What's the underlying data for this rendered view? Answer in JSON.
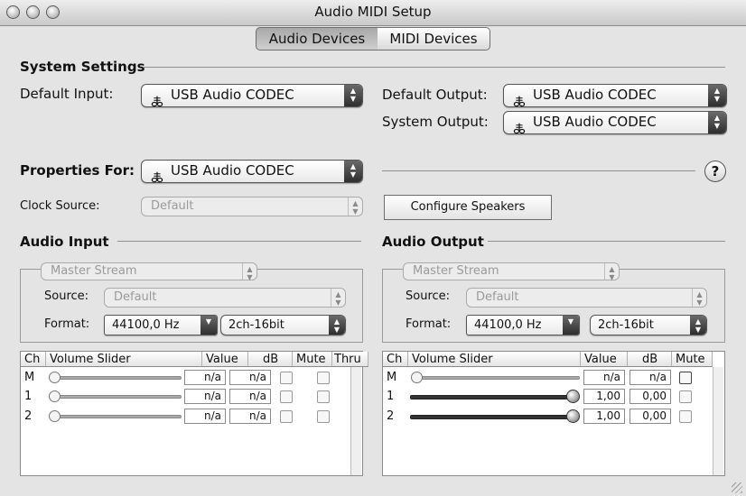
{
  "window": {
    "title": "Audio MIDI Setup"
  },
  "tabs": [
    {
      "label": "Audio Devices",
      "selected": true
    },
    {
      "label": "MIDI Devices",
      "selected": false
    }
  ],
  "system_settings": {
    "heading": "System Settings",
    "default_input_label": "Default Input:",
    "default_input_value": "USB Audio CODEC",
    "default_output_label": "Default Output:",
    "default_output_value": "USB Audio CODEC",
    "system_output_label": "System Output:",
    "system_output_value": "USB Audio CODEC"
  },
  "properties": {
    "label": "Properties For:",
    "value": "USB Audio CODEC",
    "help_label": "?",
    "clock_source_label": "Clock Source:",
    "clock_source_value": "Default",
    "configure_button": "Configure Speakers"
  },
  "audio_input": {
    "heading": "Audio Input",
    "stream": "Master Stream",
    "source_label": "Source:",
    "source_value": "Default",
    "format_label": "Format:",
    "format_rate": "44100,0 Hz",
    "format_bits": "2ch-16bit",
    "columns": [
      "Ch",
      "Volume Slider",
      "Value",
      "dB",
      "Mute",
      "Thru"
    ],
    "rows": [
      {
        "ch": "M",
        "value": "n/a",
        "db": "n/a",
        "level": 0
      },
      {
        "ch": "1",
        "value": "n/a",
        "db": "n/a",
        "level": 0
      },
      {
        "ch": "2",
        "value": "n/a",
        "db": "n/a",
        "level": 0
      }
    ]
  },
  "audio_output": {
    "heading": "Audio Output",
    "stream": "Master Stream",
    "source_label": "Source:",
    "source_value": "Default",
    "format_label": "Format:",
    "format_rate": "44100,0 Hz",
    "format_bits": "2ch-16bit",
    "columns": [
      "Ch",
      "Volume Slider",
      "Value",
      "dB",
      "Mute"
    ],
    "rows": [
      {
        "ch": "M",
        "value": "n/a",
        "db": "n/a",
        "level": 0
      },
      {
        "ch": "1",
        "value": "1,00",
        "db": "0,00",
        "level": 1
      },
      {
        "ch": "2",
        "value": "1,00",
        "db": "0,00",
        "level": 1
      }
    ]
  },
  "icons": {
    "usb": "usb-icon",
    "popup_arrows": "updown-arrows-icon"
  }
}
